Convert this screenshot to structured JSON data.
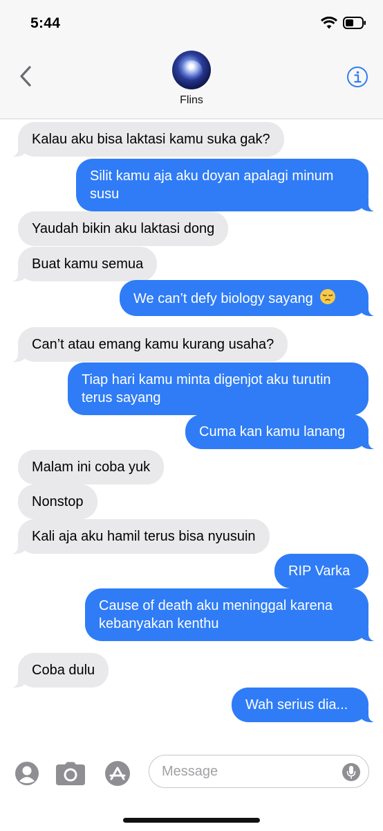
{
  "status_bar": {
    "time": "5:44"
  },
  "header": {
    "contact_name": "Flins"
  },
  "messages": [
    {
      "sender": "them",
      "text": "Kalau aku bisa laktasi kamu suka gak?"
    },
    {
      "sender": "me",
      "lines": [
        "Silit kamu aja aku doyan apalagi minum",
        "susu"
      ]
    },
    {
      "sender": "them",
      "text": "Yaudah bikin aku laktasi dong"
    },
    {
      "sender": "them",
      "text": "Buat kamu semua"
    },
    {
      "sender": "me",
      "text": "We can’t defy biology sayang",
      "emoji": "pensive-face"
    },
    {
      "sender": "them",
      "text": "Can’t atau emang kamu kurang usaha?"
    },
    {
      "sender": "me",
      "lines": [
        "Tiap hari kamu minta digenjot aku turutin",
        "terus sayang"
      ]
    },
    {
      "sender": "me",
      "text": "Cuma kan kamu lanang"
    },
    {
      "sender": "them",
      "text": "Malam ini coba yuk"
    },
    {
      "sender": "them",
      "text": "Nonstop"
    },
    {
      "sender": "them",
      "text": "Kali aja aku hamil terus bisa nyusuin"
    },
    {
      "sender": "me",
      "text": "RIP Varka"
    },
    {
      "sender": "me",
      "lines": [
        "Cause of death aku meninggal karena",
        "kebanyakan kenthu"
      ]
    },
    {
      "sender": "them",
      "text": "Coba dulu"
    },
    {
      "sender": "me",
      "text": "Wah serius dia..."
    }
  ],
  "input_bar": {
    "placeholder": "Message"
  },
  "colors": {
    "sent_bubble": "#2f7cf6",
    "received_bubble": "#e9e9eb",
    "accent": "#2f7cf6"
  }
}
